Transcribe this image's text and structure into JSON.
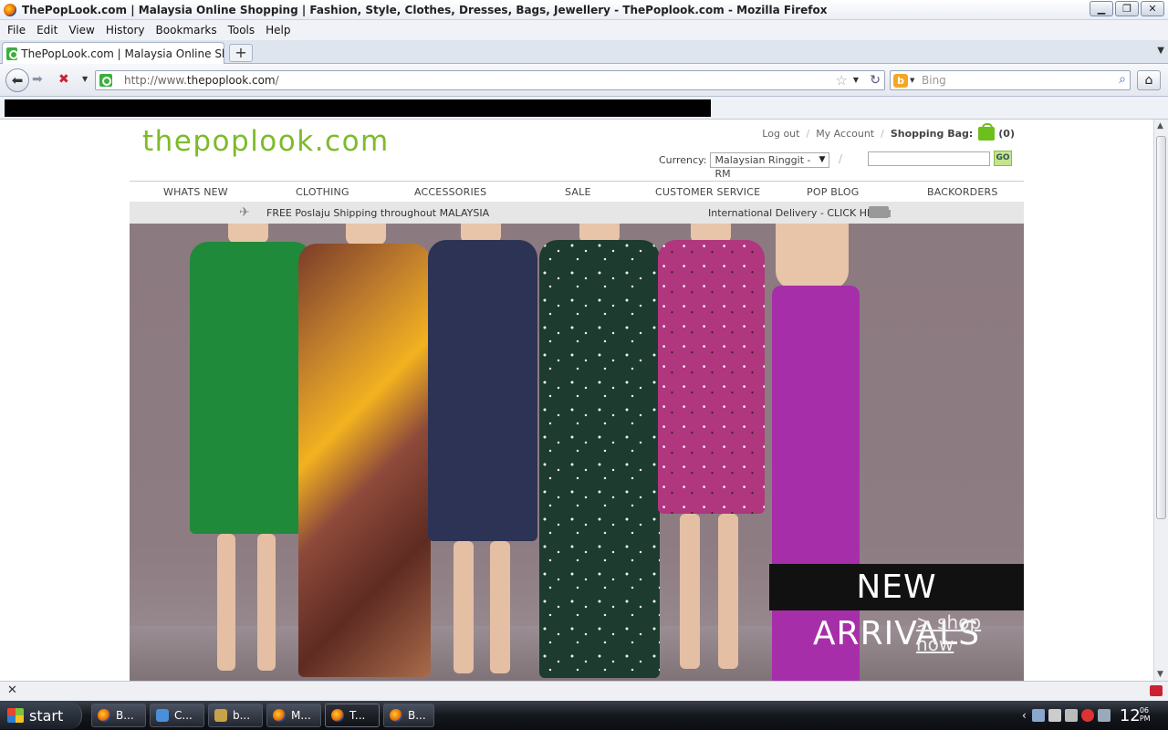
{
  "window": {
    "title": "ThePopLook.com | Malaysia Online Shopping | Fashion, Style, Clothes, Dresses, Bags, Jewellery - ThePoplook.com - Mozilla Firefox",
    "min": "▁",
    "max": "❐",
    "close": "✕"
  },
  "menu": [
    "File",
    "Edit",
    "View",
    "History",
    "Bookmarks",
    "Tools",
    "Help"
  ],
  "tab": {
    "label": "ThePopLook.com | Malaysia Online Shop...",
    "new": "+"
  },
  "nav": {
    "url_prefix": "http://www.",
    "url_domain": "thepoplook.com",
    "url_suffix": "/",
    "search_placeholder": "Bing"
  },
  "site": {
    "logo": "thepoplook.com",
    "logout": "Log out",
    "account": "My Account",
    "bag_label": "Shopping Bag:",
    "bag_count": "(0)",
    "currency_label": "Currency:",
    "currency_value": "Malaysian Ringgit - RM",
    "go": "GO",
    "nav": [
      "WHATS NEW",
      "CLOTHING",
      "ACCESSORIES",
      "SALE",
      "CUSTOMER SERVICE",
      "POP BLOG",
      "BACKORDERS"
    ],
    "ship_free": "FREE Poslaju Shipping throughout MALAYSIA",
    "ship_intl": "International Delivery - CLICK HERE",
    "banner_title": "NEW ARRIVALS",
    "banner_link": "> shop now"
  },
  "taskbar": {
    "start": "start",
    "tasks": [
      "B...",
      "C...",
      "b...",
      "M...",
      "T...",
      "B..."
    ],
    "clock_hour": "12",
    "clock_min": "06",
    "clock_ampm": "PM"
  },
  "colors": {
    "brand_green": "#7dbb2a",
    "banner_bg": "#8b7a80"
  }
}
